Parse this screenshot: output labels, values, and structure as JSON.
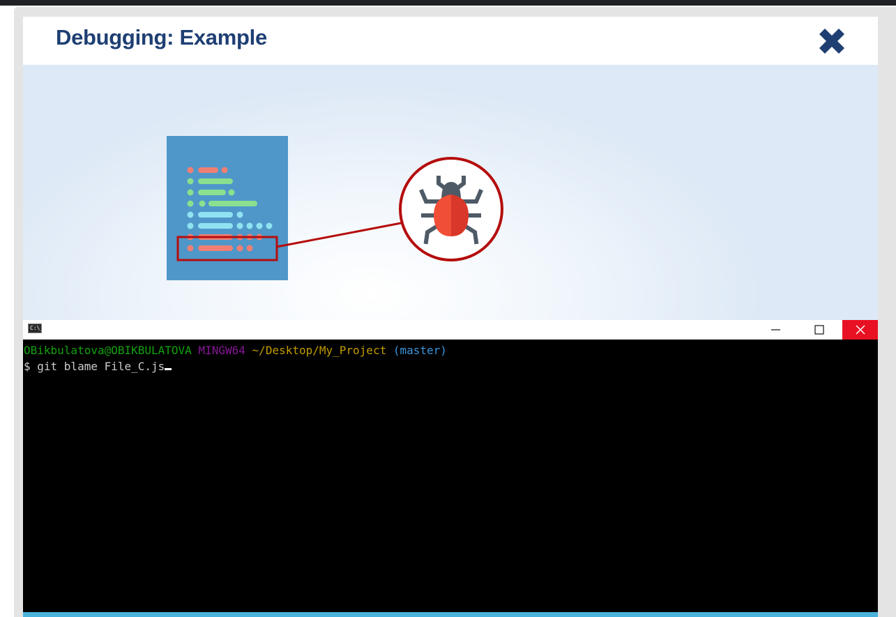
{
  "dialog": {
    "title": "Debugging: Example",
    "close_icon": "close-x-icon"
  },
  "illustration": {
    "document_icon": "code-file-icon",
    "bug_icon": "bug-icon",
    "highlight_color": "#b50d0d",
    "document_color": "#4f97c9"
  },
  "terminal": {
    "window_icon": "cmd-icon",
    "window_icon_text": "C:\\_",
    "buttons": [
      "minimize-icon",
      "maximize-icon",
      "close-icon"
    ],
    "prompt": {
      "user_host": "OBikbulatova@OBIKBULATOVA",
      "shell": "MINGW64",
      "path": "~/Desktop/My_Project",
      "branch": "(master)"
    },
    "command_prefix": "$ ",
    "command": "git blame File_C.js"
  }
}
